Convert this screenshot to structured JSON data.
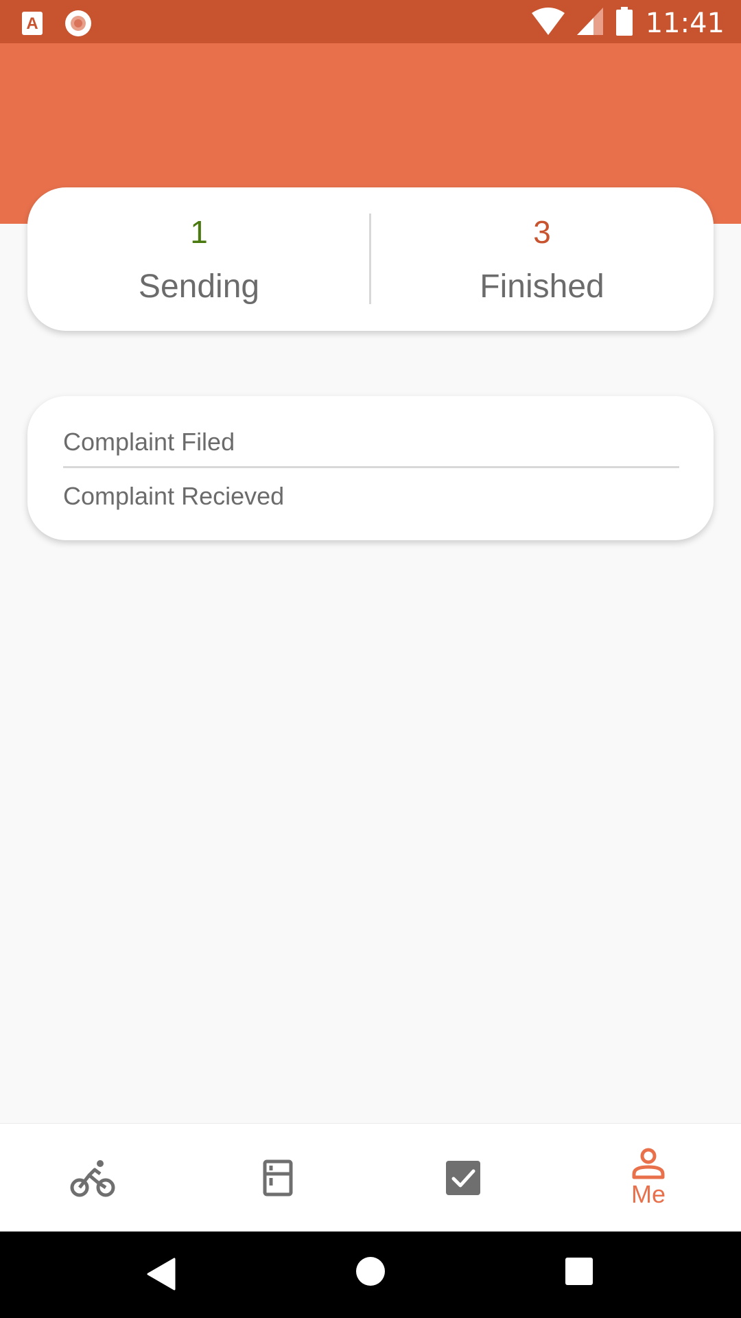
{
  "status_bar": {
    "time": "11:41",
    "icons": [
      "app-a-icon",
      "record-icon",
      "wifi-icon",
      "signal-icon",
      "battery-icon"
    ]
  },
  "summary": {
    "sending": {
      "count": "1",
      "label": "Sending",
      "color": "#4a7a0f"
    },
    "finished": {
      "count": "3",
      "label": "Finished",
      "color": "#c8542f"
    }
  },
  "complaints": {
    "items": [
      "Complaint Filed",
      "Complaint Recieved"
    ]
  },
  "bottom_nav": {
    "items": [
      {
        "icon": "bike-icon",
        "label": ""
      },
      {
        "icon": "fridge-icon",
        "label": ""
      },
      {
        "icon": "checkbox-icon",
        "label": ""
      },
      {
        "icon": "person-icon",
        "label": "Me",
        "active": true
      }
    ],
    "active_color": "#e8714c",
    "inactive_color": "#6f6f6f"
  },
  "system_nav": {
    "icons": [
      "back-icon",
      "home-icon",
      "recents-icon"
    ]
  },
  "colors": {
    "status_bar": "#c8542f",
    "header": "#e8714c",
    "background": "#f9f9f9"
  }
}
